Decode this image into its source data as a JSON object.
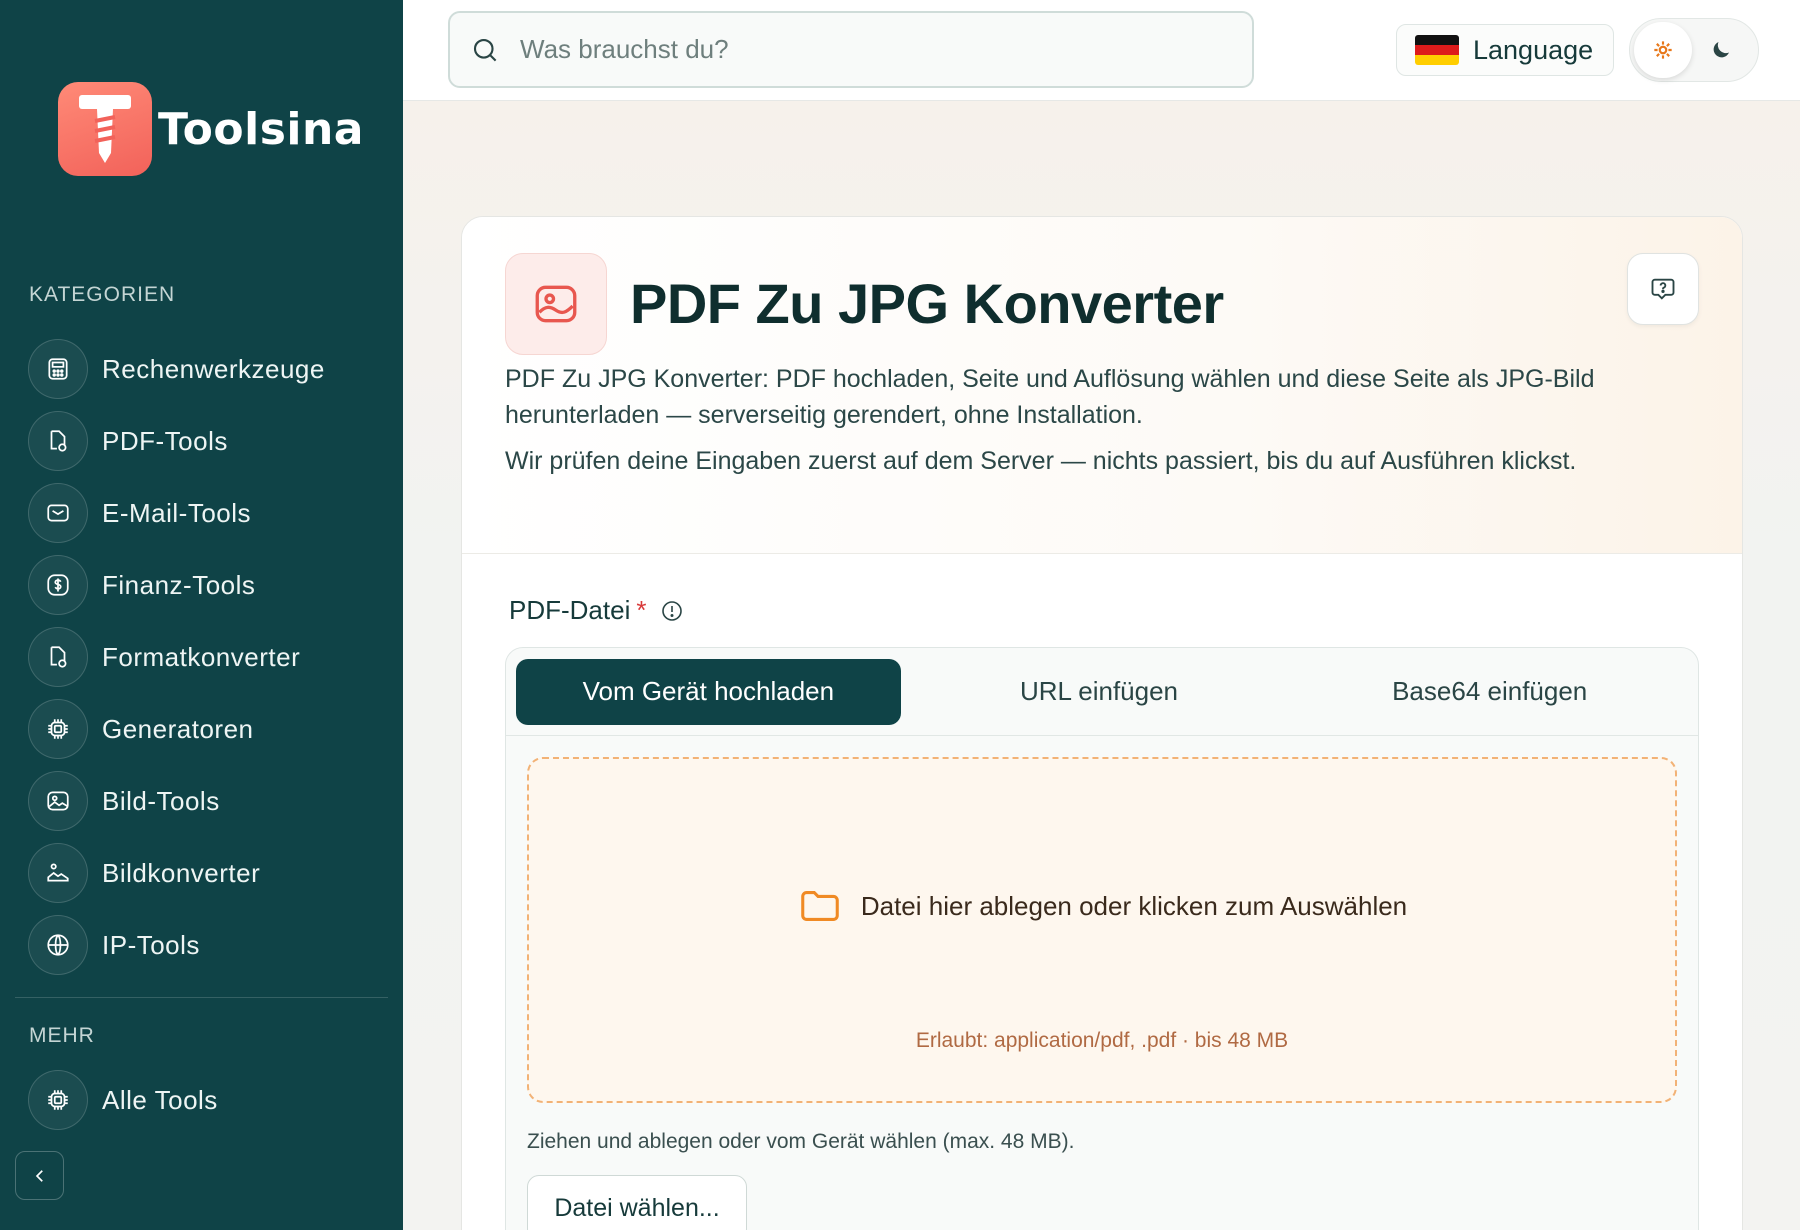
{
  "brand": {
    "name": "Toolsina"
  },
  "sidebar": {
    "categories_label": "KATEGORIEN",
    "items": [
      {
        "label": "Rechenwerkzeuge",
        "icon": "calculator-icon"
      },
      {
        "label": "PDF-Tools",
        "icon": "pdf-icon"
      },
      {
        "label": "E-Mail-Tools",
        "icon": "mail-icon"
      },
      {
        "label": "Finanz-Tools",
        "icon": "dollar-icon"
      },
      {
        "label": "Formatkonverter",
        "icon": "convert-icon"
      },
      {
        "label": "Generatoren",
        "icon": "chip-icon"
      },
      {
        "label": "Bild-Tools",
        "icon": "image-icon"
      },
      {
        "label": "Bildkonverter",
        "icon": "image-convert-icon"
      },
      {
        "label": "IP-Tools",
        "icon": "globe-icon"
      }
    ],
    "more_label": "MEHR",
    "more_items": [
      {
        "label": "Alle Tools",
        "icon": "chip-icon"
      }
    ]
  },
  "topbar": {
    "search_placeholder": "Was brauchst du?",
    "language_label": "Language"
  },
  "tool": {
    "title": "PDF Zu JPG Konverter",
    "description_1": "PDF Zu JPG Konverter: PDF hochladen, Seite und Auflösung wählen und diese Seite als JPG-Bild herunterladen — serverseitig gerendert, ohne Installation.",
    "description_2": "Wir prüfen deine Eingaben zuerst auf dem Server — nichts passiert, bis du auf Ausführen klickst."
  },
  "form": {
    "field_label": "PDF-Datei",
    "required_mark": "*",
    "tabs": [
      "Vom Gerät hochladen",
      "URL einfügen",
      "Base64 einfügen"
    ],
    "drop_text": "Datei hier ablegen oder klicken zum Auswählen",
    "allowed_text": "Erlaubt: application/pdf, .pdf · bis 48 MB",
    "hint": "Ziehen und ablegen oder vom Gerät wählen (max. 48 MB).",
    "choose_button": "Datei wählen..."
  },
  "colors": {
    "sidebar": "#0f4347",
    "accent": "#f2625a",
    "dropzone_border": "#f2b276"
  }
}
